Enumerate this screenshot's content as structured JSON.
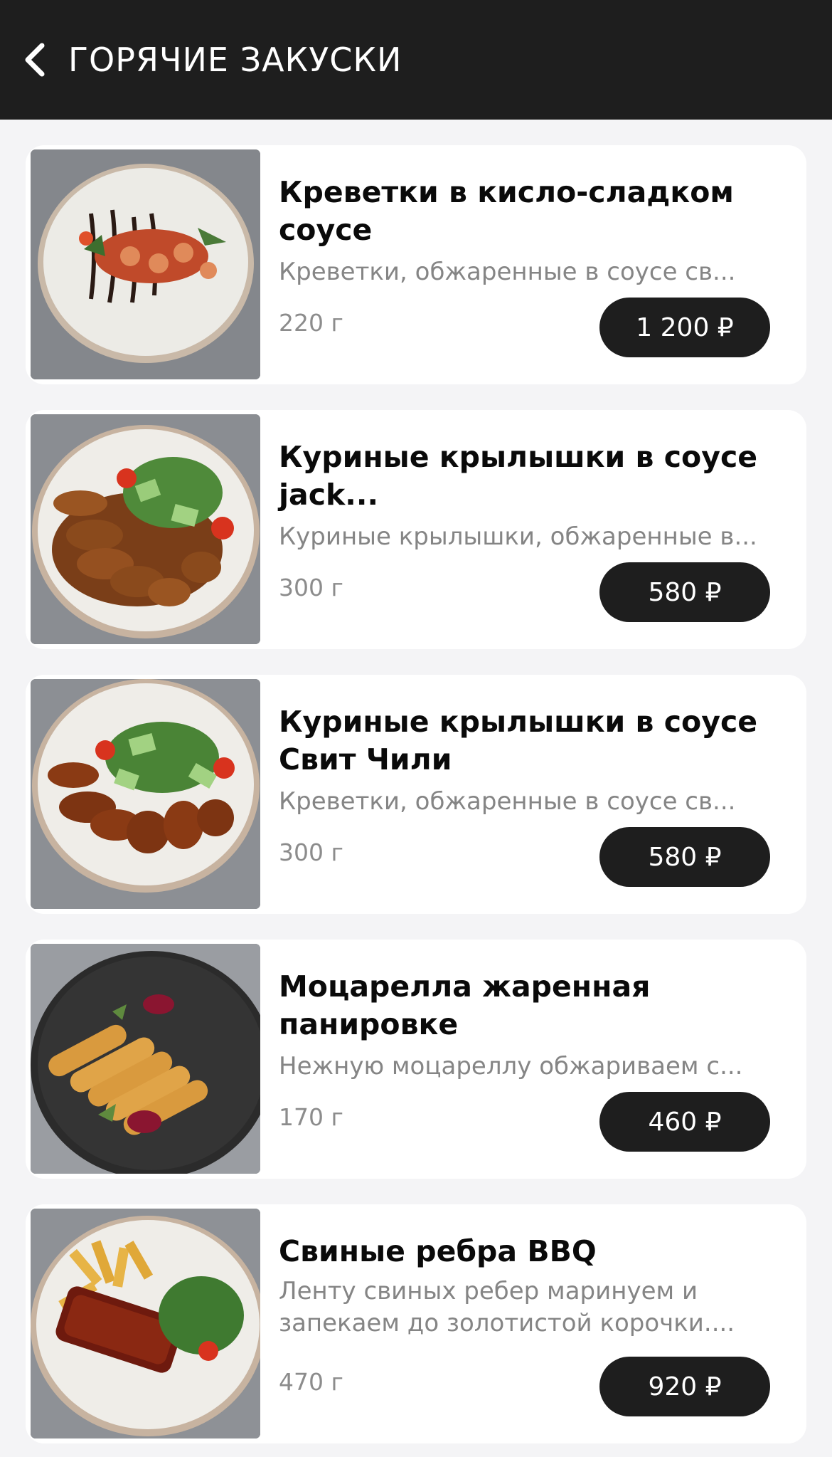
{
  "header": {
    "title": "ГОРЯЧИЕ ЗАКУСКИ",
    "back_icon": "chevron-left-icon"
  },
  "items": [
    {
      "title": "Креветки в кисло-сладком соусе",
      "description": "Креветки, обжаренные в соусе св...",
      "weight": "220 г",
      "price": "1 200 ₽"
    },
    {
      "title": "Куриные крылышки в соусе jack...",
      "description": "Куриные крылышки, обжаренные в...",
      "weight": "300 г",
      "price": "580 ₽"
    },
    {
      "title": "Куриные крылышки в соусе Свит Чили",
      "description": "Креветки, обжаренные в соусе св...",
      "weight": "300 г",
      "price": "580 ₽"
    },
    {
      "title": "Моцарелла жаренная панировке",
      "description": "Нежную моцареллу обжариваем с...",
      "weight": "170 г",
      "price": "460 ₽"
    },
    {
      "title": "Свиные ребра BBQ",
      "description": "Ленту свиных ребер маринуем и запекаем до золотистой корочки....",
      "weight": "470 г",
      "price": "920 ₽"
    }
  ],
  "colors": {
    "header_bg": "#1e1e1e",
    "page_bg": "#f4f4f6",
    "price_button_bg": "#1e1e1e",
    "muted_text": "#858585"
  }
}
